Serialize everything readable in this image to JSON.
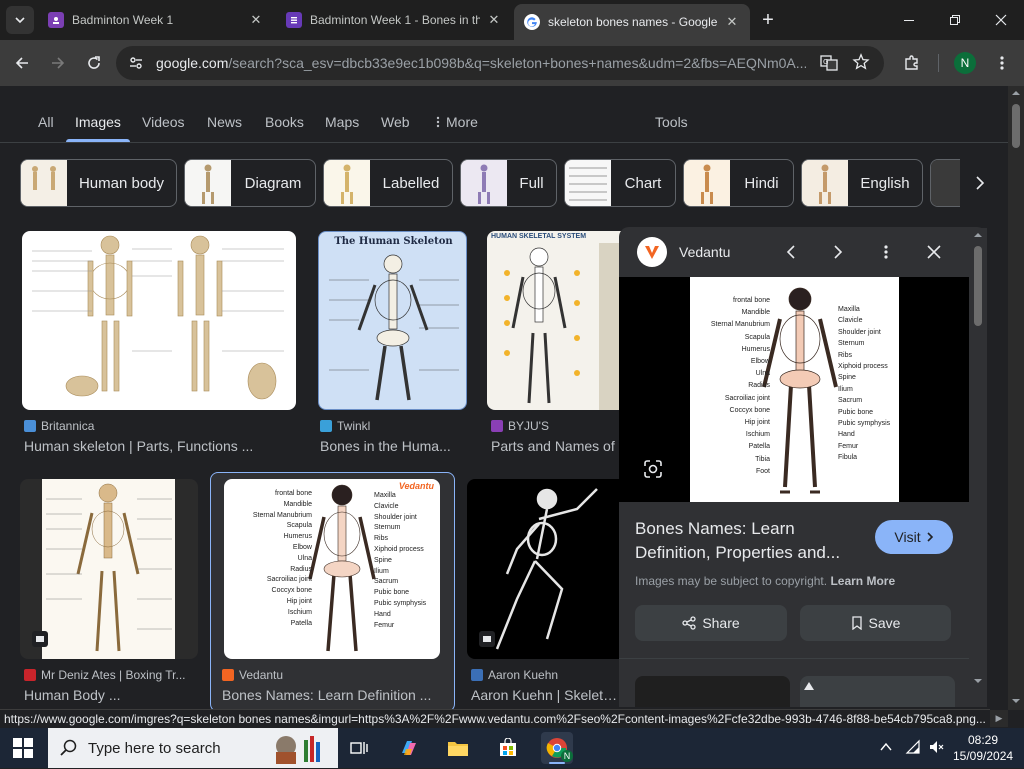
{
  "browser": {
    "tabs": [
      {
        "title": "Badminton Week 1",
        "icon": "google-classroom-icon"
      },
      {
        "title": "Badminton Week 1 - Bones in th",
        "icon": "google-forms-icon"
      },
      {
        "title": "skeleton bones names - Google",
        "icon": "google-icon",
        "active": true
      }
    ],
    "url_host": "google.com",
    "url_path": "/search?sca_esv=dbcb33e9ec1b098b&q=skeleton+bones+names&udm=2&fbs=AEQNm0A...",
    "profile_initial": "N"
  },
  "search": {
    "nav_tabs": [
      "All",
      "Images",
      "Videos",
      "News",
      "Books",
      "Maps",
      "Web",
      "More",
      "Tools"
    ],
    "active_tab": "Images",
    "chips": [
      "Human body",
      "Diagram",
      "Labelled",
      "Full",
      "Chart",
      "Hindi",
      "English"
    ]
  },
  "results": [
    {
      "source": "Britannica",
      "title": "Human skeleton | Parts, Functions ..."
    },
    {
      "source": "Twinkl",
      "title": "Bones in the Huma..."
    },
    {
      "source": "BYJU'S",
      "title": "Parts and Names of"
    },
    {
      "source": "Mr Deniz Ates | Boxing Tr...",
      "title": "Human Body ..."
    },
    {
      "source": "Vedantu",
      "title": "Bones Names: Learn Definition ..."
    },
    {
      "source": "Aaron Kuehn",
      "title": "Aaron Kuehn | Skeleton ..."
    }
  ],
  "thumb_text": {
    "twinkl_title": "The Human Skeleton",
    "byjus_title": "HUMAN SKELETAL SYSTEM",
    "vedantu_brand": "Vedantu",
    "vedantu_labels_left": [
      "frontal bone",
      "Mandible",
      "Sternal Manubrium",
      "Scapula",
      "Humerus",
      "Elbow",
      "Ulna",
      "Radius",
      "Sacroiliac joint",
      "Coccyx bone",
      "Hip joint",
      "Ischium",
      "Patella"
    ],
    "vedantu_labels_right": [
      "Maxilla",
      "Clavicle",
      "Shoulder joint",
      "Sternum",
      "Ribs",
      "Xiphoid process",
      "Spine",
      "Ilium",
      "Sacrum",
      "Pubic bone",
      "Pubic symphysis",
      "Hand",
      "Femur"
    ]
  },
  "panel": {
    "source": "Vedantu",
    "title": "Bones Names: Learn Definition, Properties and...",
    "visit_label": "Visit",
    "copyright_text": "Images may be subject to copyright.",
    "learn_more": "Learn More",
    "share_label": "Share",
    "save_label": "Save",
    "preview_labels_left": [
      "frontal bone",
      "Mandible",
      "Sternal Manubrium",
      "Scapula",
      "Humerus",
      "Elbow",
      "Ulna",
      "Radius",
      "Sacroiliac joint",
      "Coccyx bone",
      "Hip joint",
      "Ischium",
      "Patella",
      "Tibia",
      "Foot"
    ],
    "preview_labels_right": [
      "Maxilla",
      "Clavicle",
      "Shoulder joint",
      "Sternum",
      "Ribs",
      "Xiphoid process",
      "Spine",
      "Ilium",
      "Sacrum",
      "Pubic bone",
      "Pubic symphysis",
      "Hand",
      "Femur",
      "Fibula"
    ]
  },
  "status_url": "https://www.google.com/imgres?q=skeleton bones names&imgurl=https%3A%2F%2Fwww.vedantu.com%2Fseo%2Fcontent-images%2Fcfe32dbe-993b-4746-8f88-be54cb795ca8.png...",
  "taskbar": {
    "search_placeholder": "Type here to search",
    "time": "08:29",
    "date": "15/09/2024"
  },
  "colors": {
    "accent": "#8ab4f8",
    "background": "#202124",
    "panel": "#303134"
  }
}
